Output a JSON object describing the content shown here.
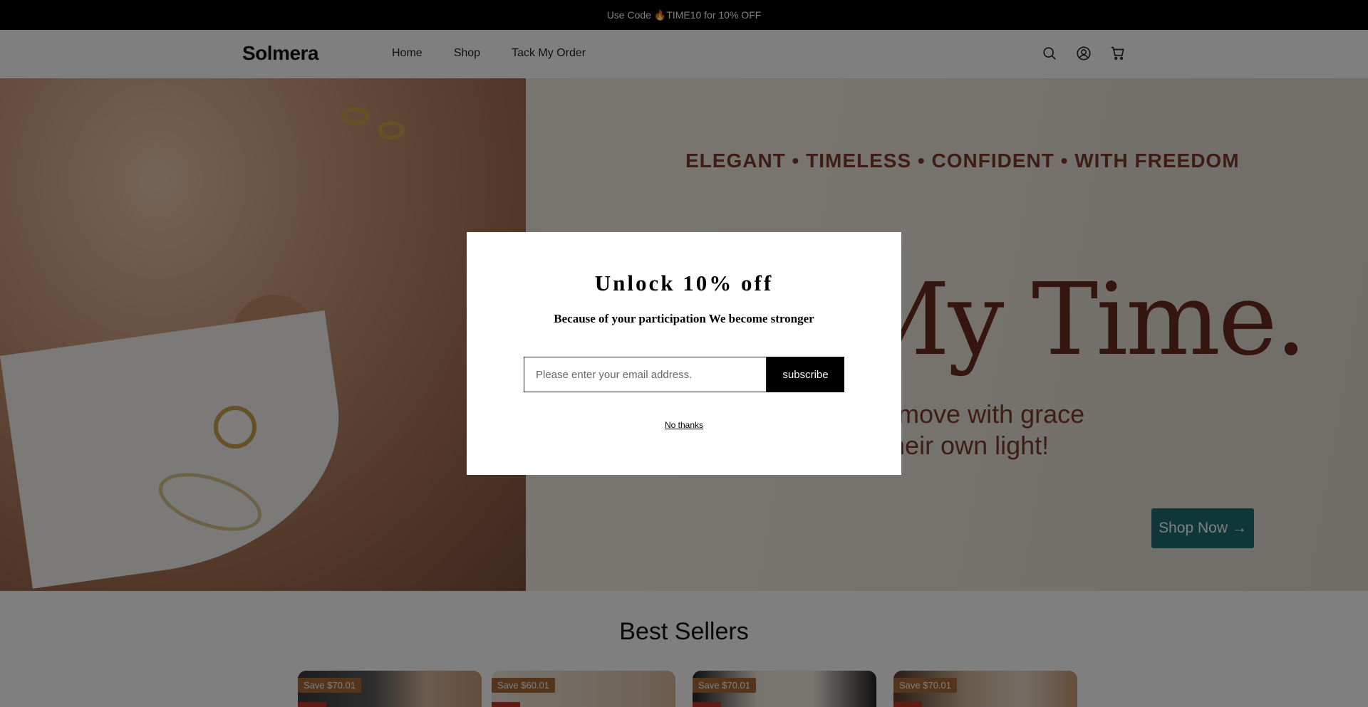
{
  "announcement": {
    "text": "Use Code 🔥TIME10   for 10% OFF"
  },
  "header": {
    "logo": "Solmera",
    "nav": [
      "Home",
      "Shop",
      "Tack My Order"
    ],
    "icons": [
      "search-icon",
      "account-icon",
      "cart-icon"
    ]
  },
  "hero": {
    "tagline": "ELEGANT • TIMELESS • CONFIDENT • WITH FREEDOM",
    "title": "My Time.",
    "subtitle_line1": "ho move with grace",
    "subtitle_line2": "n their own light!",
    "cta": "Shop Now →",
    "cta_color": "#1f6f74"
  },
  "best_sellers": {
    "title": "Best Sellers",
    "products": [
      {
        "badge": "Save $70.01"
      },
      {
        "badge": "Save $60.01"
      },
      {
        "badge": "Save $70.01"
      },
      {
        "badge": "Save $70.01"
      }
    ]
  },
  "popup": {
    "title": "Unlock 10% off",
    "subtitle": "Because of your participation We become stronger",
    "email_placeholder": "Please enter your email address.",
    "subscribe_label": "subscribe",
    "dismiss_label": "No thanks"
  }
}
